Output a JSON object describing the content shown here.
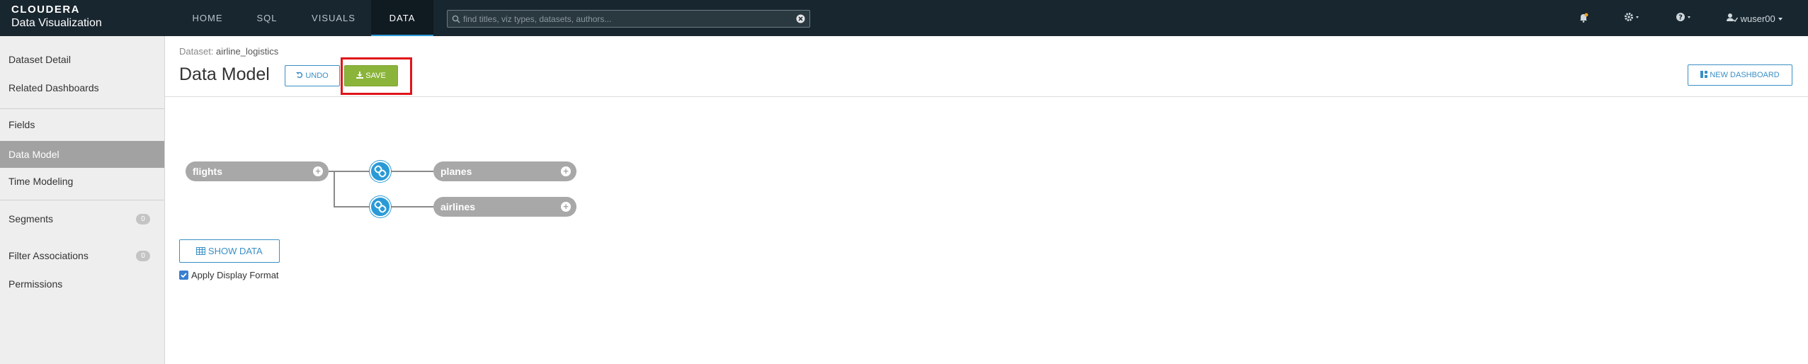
{
  "app": {
    "brand": "CLOUDERA",
    "product": "Data Visualization"
  },
  "nav": {
    "tabs": [
      {
        "label": "HOME"
      },
      {
        "label": "SQL"
      },
      {
        "label": "VISUALS"
      },
      {
        "label": "DATA",
        "active": true
      }
    ]
  },
  "search": {
    "placeholder": "find titles, viz types, datasets, authors..."
  },
  "user": {
    "name": "wuser00"
  },
  "sidebar": {
    "items": [
      {
        "label": "Dataset Detail"
      },
      {
        "label": "Related Dashboards"
      },
      {
        "label": "Fields"
      },
      {
        "label": "Data Model",
        "active": true
      },
      {
        "label": "Time Modeling"
      },
      {
        "label": "Segments",
        "badge": "0"
      },
      {
        "label": "Filter Associations",
        "badge": "0"
      },
      {
        "label": "Permissions"
      }
    ]
  },
  "breadcrumb": {
    "prefix": "Dataset:",
    "dataset_name": "airline_logistics"
  },
  "page": {
    "title": "Data Model"
  },
  "toolbar": {
    "undo_label": "UNDO",
    "save_label": "SAVE",
    "new_dashboard_label": "NEW DASHBOARD"
  },
  "model": {
    "primary_table": "flights",
    "joined_tables": [
      "planes",
      "airlines"
    ]
  },
  "show_data": {
    "label": "SHOW DATA"
  },
  "display_format": {
    "label": "Apply Display Format",
    "checked": true
  },
  "colors": {
    "topbar": "#18262f",
    "accent": "#2a9ad6",
    "save": "#8bb43a",
    "highlight": "#e0151b",
    "pill": "#a8a8a8"
  }
}
